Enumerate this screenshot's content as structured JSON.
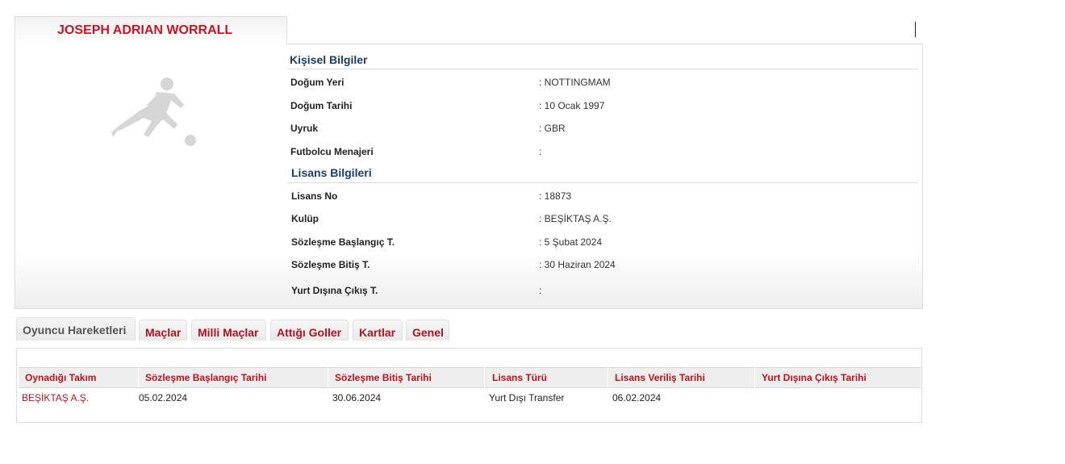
{
  "player": {
    "name": "JOSEPH ADRIAN WORRALL"
  },
  "personal": {
    "title": "Kişisel Bilgiler",
    "rows": [
      {
        "label": "Doğum Yeri",
        "value": ":  NOTTINGMAM"
      },
      {
        "label": "Doğum Tarihi",
        "value": ":  10 Ocak 1997"
      },
      {
        "label": "Uyruk",
        "value": ":  GBR"
      },
      {
        "label": "Futbolcu Menajeri",
        "value": ":"
      }
    ]
  },
  "license": {
    "title": "Lisans Bilgileri",
    "rows": [
      {
        "label": "Lisans No",
        "value": ": 18873"
      },
      {
        "label": "Kulüp",
        "value": ": BEŞİKTAŞ A.Ş."
      },
      {
        "label": "Sözleşme Başlangıç T.",
        "value": ": 5 Şubat 2024"
      },
      {
        "label": "Sözleşme Bitiş T.",
        "value": ": 30 Haziran 2024"
      },
      {
        "label": "Yurt Dışına Çıkış T.",
        "value": ":"
      }
    ]
  },
  "tabs": [
    "Oyuncu Hareketleri",
    "Maçlar",
    "Milli Maçlar",
    "Attığı Goller",
    "Kartlar",
    "Genel"
  ],
  "active_tab": "Oyuncu Hareketleri",
  "table": {
    "headers": [
      "Oynadığı Takım",
      "Sözleşme Başlangıç Tarihi",
      "Sözleşme Bitiş Tarihi",
      "Lisans Türü",
      "Lisans Veriliş Tarihi",
      "Yurt Dışına Çıkış Tarihi"
    ],
    "rows": [
      [
        "BEŞİKTAŞ A.Ş.",
        "05.02.2024",
        "30.06.2024",
        "Yurt Dışı Transfer",
        "06.02.2024",
        ""
      ]
    ]
  },
  "colors": {
    "accent_red": "#c0101b",
    "section_blue": "#1a3d6e"
  },
  "icons": {
    "player_photo": "player-silhouette-icon"
  }
}
